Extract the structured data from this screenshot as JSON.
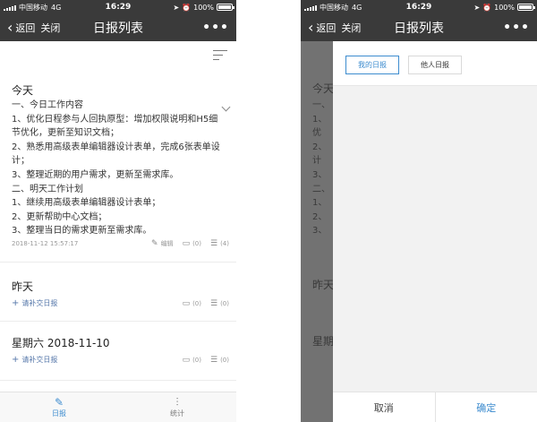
{
  "status": {
    "carrier": "中国移动",
    "network": "4G",
    "time": "16:29",
    "battery": "100%"
  },
  "nav": {
    "back_label": "返回",
    "close_label": "关闭",
    "title": "日报列表",
    "more": "•••"
  },
  "reports": [
    {
      "day": "今天",
      "lines": [
        "一、今日工作内容",
        "1、优化日程参与人回执原型：增加权限说明和H5细节优化，更新至知识文档；",
        "2、熟悉用高级表单编辑器设计表单，完成6张表单设计；",
        "3、整理近期的用户需求，更新至需求库。",
        "二、明天工作计划",
        "1、继续用高级表单编辑器设计表单；",
        "2、更新帮助中心文档；",
        "3、整理当日的需求更新至需求库。"
      ],
      "timestamp": "2018-11-12 15:57:17",
      "edit_label": "编辑",
      "comments": "(0)",
      "reads": "(4)"
    },
    {
      "day": "昨天",
      "submit_label": "请补交日报",
      "comments": "(0)",
      "reads": "(0)"
    },
    {
      "day": "星期六 2018-11-10",
      "submit_label": "请补交日报",
      "comments": "(0)",
      "reads": "(0)"
    }
  ],
  "tabbar": {
    "tab1": "日报",
    "tab2": "统计"
  },
  "overlay": {
    "fragments": [
      "今天",
      "一、",
      "1、",
      "优",
      "2、",
      "计",
      "3、",
      "二、",
      "1、",
      "2、",
      "3、",
      "昨天",
      "星期"
    ],
    "my_reports": "我的日报",
    "others_reports": "他人日报",
    "cancel": "取消",
    "confirm": "确定"
  },
  "colors": {
    "accent": "#3d8ccf",
    "navbar": "#3a3a3a",
    "link": "#5577aa"
  }
}
